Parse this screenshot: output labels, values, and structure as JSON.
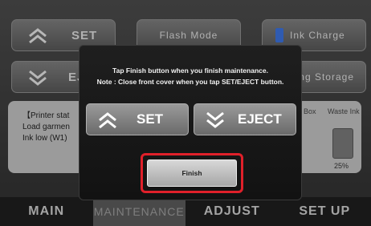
{
  "background": {
    "set_label": "SET",
    "eject_label": "EJE",
    "flash_mode_label": "Flash Mode",
    "ink_charge_label": "Ink Charge",
    "storage_label": "ing Storage",
    "status": {
      "line1": "【Printer stat",
      "line2": "Load garmen",
      "line3": "Ink low (W1)"
    },
    "box_label": "Box",
    "waste_ink_label": "Waste Ink",
    "waste_ink_percent": "25%",
    "waste_ink_level": 0.25
  },
  "tabs": [
    {
      "label": "MAIN"
    },
    {
      "label": "MAINTENANCE"
    },
    {
      "label": "ADJUST"
    },
    {
      "label": "SET UP"
    }
  ],
  "dialog": {
    "message_line1": "Tap Finish button when you finish maintenance.",
    "message_line2": "Note : Close front cover when you tap SET/EJECT button.",
    "set_label": "SET",
    "eject_label": "EJECT",
    "finish_label": "Finish"
  },
  "colors": {
    "highlight": "#e0202a",
    "ink_blue": "#3a6fd8"
  }
}
